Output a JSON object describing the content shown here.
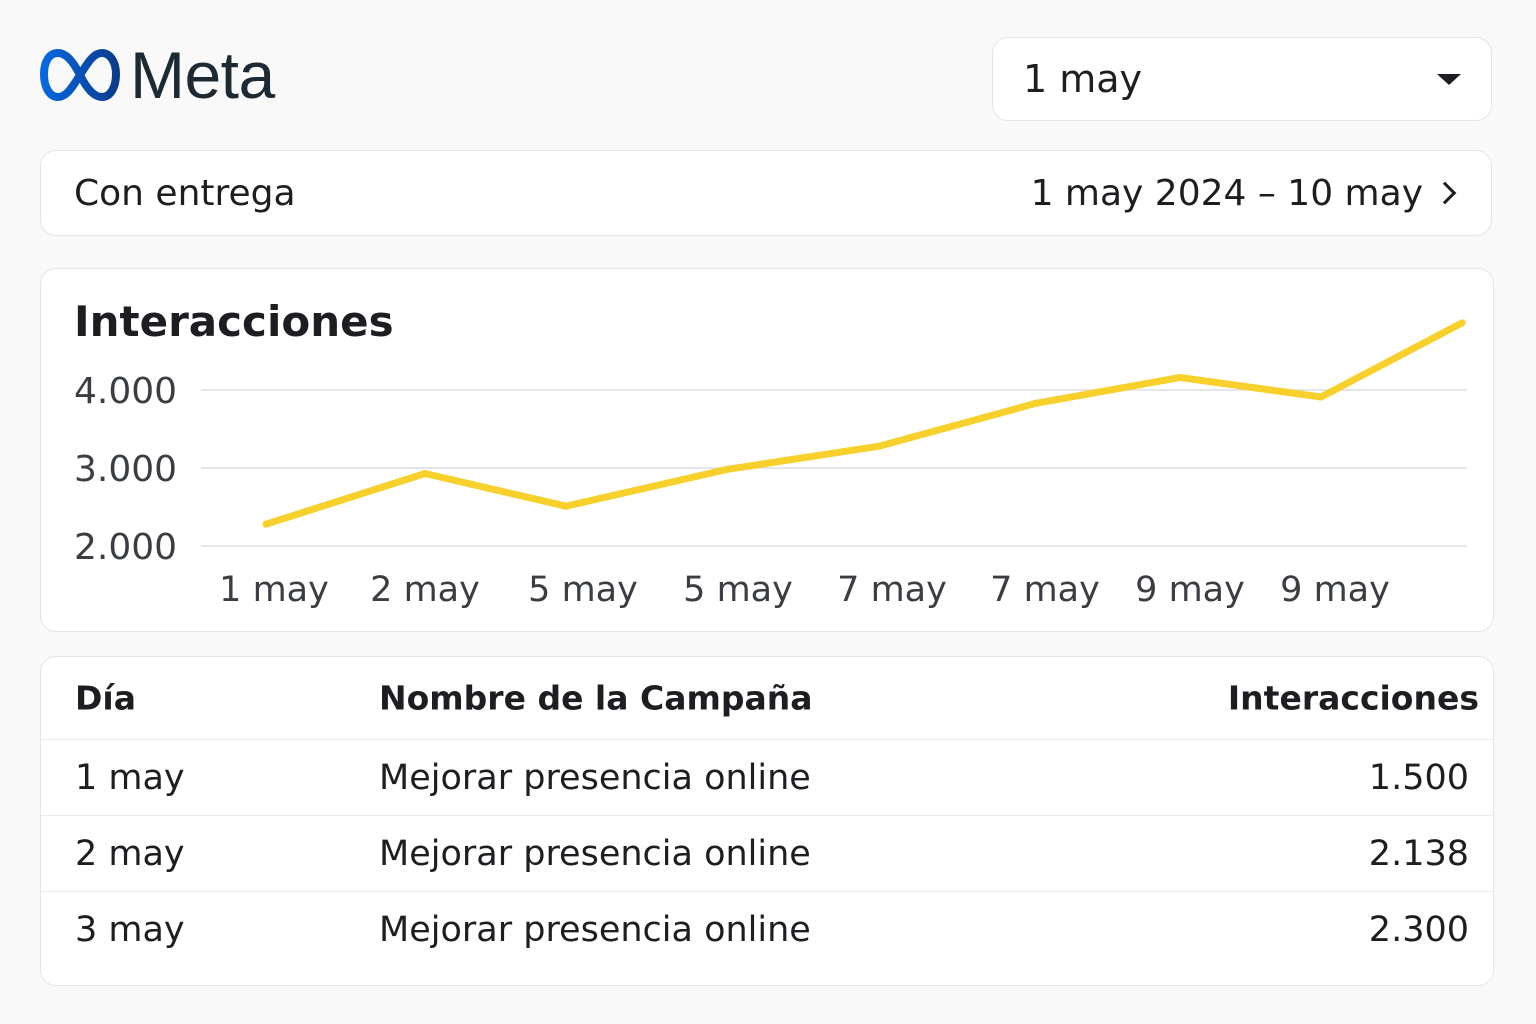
{
  "brand": {
    "name": "Meta",
    "logo_icon": "meta-infinity-logo",
    "colors": {
      "logo_start": "#0668e1",
      "logo_end": "#0a3c8e",
      "text": "#1c2b33"
    }
  },
  "date_selector": {
    "value": "1 may",
    "icon": "caret-down-icon"
  },
  "filter": {
    "status": "Con entrega",
    "range": "1 may 2024 – 10 may",
    "icon": "chevron-right-icon"
  },
  "chart": {
    "title": "Interacciones",
    "y_ticks": [
      "4.000",
      "3.000",
      "2.000"
    ],
    "x_ticks": [
      "1 may",
      "2 may",
      "5 may",
      "5 may",
      "7 may",
      "7 may",
      "9 may",
      "9 may"
    ]
  },
  "chart_data": {
    "type": "line",
    "title": "Interacciones",
    "xlabel": "",
    "ylabel": "",
    "x": [
      "1 may",
      "2 may",
      "5 may",
      "5 may",
      "7 may",
      "7 may",
      "9 may",
      "9 may",
      ""
    ],
    "series": [
      {
        "values": [
          2280,
          2930,
          2510,
          2980,
          3280,
          3830,
          4160,
          3910,
          4860
        ]
      }
    ],
    "ylim": [
      2000,
      4000
    ],
    "grid": true,
    "line_color": "#f7d02c",
    "gridline_color": "#dcdfe3"
  },
  "table": {
    "columns": [
      "Día",
      "Nombre de la Campaña",
      "Interacciones"
    ],
    "rows": [
      {
        "day": "1 may",
        "campaign": "Mejorar presencia online",
        "value": "1.500"
      },
      {
        "day": "2 may",
        "campaign": "Mejorar presencia online",
        "value": "2.138"
      },
      {
        "day": "3 may",
        "campaign": "Mejorar presencia online",
        "value": "2.300"
      }
    ]
  }
}
